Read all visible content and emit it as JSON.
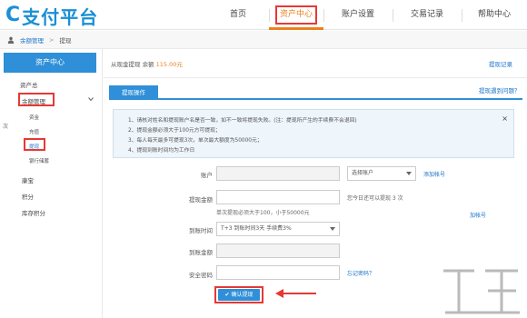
{
  "header": {
    "logo_mark": "C",
    "logo_text": "支付平台",
    "nav": [
      {
        "label": "首页"
      },
      {
        "label": "资产中心"
      },
      {
        "label": "账户设置"
      },
      {
        "label": "交易记录"
      },
      {
        "label": "帮助中心"
      }
    ],
    "active_color": "#e8821e"
  },
  "breadcrumb": {
    "items": [
      "余额管理",
      "提现"
    ]
  },
  "sidebar": {
    "head": "资产中心",
    "items": [
      {
        "label": "资产总"
      },
      {
        "label": "余额管理"
      },
      {
        "label": "资金"
      },
      {
        "label": "充值"
      },
      {
        "label": "提现"
      },
      {
        "label": "银行储蓄"
      },
      {
        "label": "康宝"
      },
      {
        "label": "积分"
      },
      {
        "label": "库存积分"
      }
    ],
    "partial_text": "次"
  },
  "main": {
    "balance_prefix": "从现金提现 余额",
    "balance_amount": "115.00元",
    "withdraw_record_link": "提现记录",
    "tab_label": "提现操作",
    "problem_link": "提现遇到问题？",
    "notice": [
      "1、请核对姓名和提现账户名是否一致，如不一致将提现失败。(注：提现所产生的手续费不会退回)",
      "2、提现金额必须大于100元方可提现；",
      "3、每人每天最多可提现3次，单次最大额度为50000元；",
      "4、提现到账时间均为工作日"
    ],
    "form": {
      "account_label": "账户",
      "account_select": "选择账户",
      "add_account_link": "添加帐号",
      "amount_label": "提现金额",
      "amount_hint": "您今日还可以提现 3 次",
      "amount_rule": "单次提现必须大于100，小于50000元",
      "add_link_2": "加帐号",
      "arrival_label": "到账时间",
      "arrival_select": "T+3 到账时间3天 手续费3%",
      "arrival_amount_label": "到账金额",
      "password_label": "安全密码",
      "forgot_link": "忘记密码？",
      "confirm_button": "确认提现"
    }
  },
  "colors": {
    "brand_blue": "#2f8fd8",
    "highlight_red": "#e53935",
    "link_blue": "#1a73c8"
  }
}
